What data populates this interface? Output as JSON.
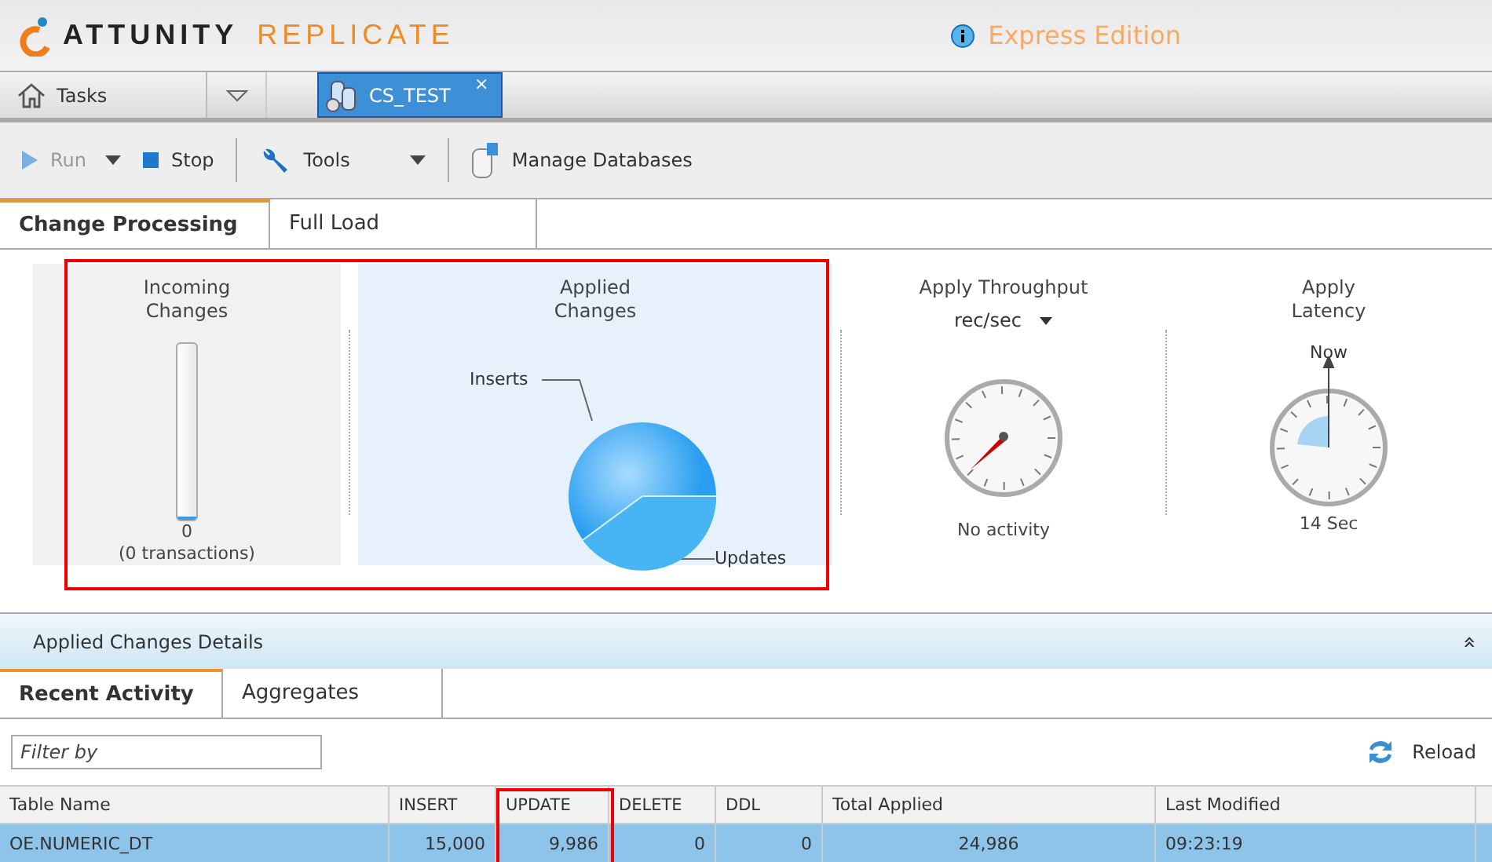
{
  "header": {
    "brand_left": "ATTUNITY",
    "brand_right": "REPLICATE",
    "edition": "Express Edition"
  },
  "task_tabs": [
    {
      "label": "Tasks",
      "kind": "home",
      "selected": false
    },
    {
      "label": "CS_TEST",
      "kind": "task",
      "selected": true,
      "close": "×"
    }
  ],
  "toolbar": [
    {
      "label": "Run",
      "kind": "run",
      "disabled": true,
      "dropdown": true
    },
    {
      "label": "Stop",
      "kind": "stop",
      "disabled": false,
      "dropdown": false
    },
    {
      "label": "Tools",
      "kind": "tools",
      "disabled": false,
      "dropdown": true
    },
    {
      "label": "Manage Databases",
      "kind": "db",
      "disabled": false,
      "dropdown": false
    }
  ],
  "view_tabs": [
    {
      "label": "Change Processing",
      "selected": true
    },
    {
      "label": "Full Load",
      "selected": false
    }
  ],
  "metrics": {
    "incoming": {
      "title": "Incoming Changes",
      "level": 0.0,
      "value": "0",
      "note": "(0 transactions)"
    },
    "applied": {
      "title": "Applied Changes",
      "labels": [
        "Inserts",
        "Updates"
      ]
    },
    "throughput": {
      "title": "Apply Throughput",
      "unit": "rec/sec",
      "status": "No activity"
    },
    "latency": {
      "title": "Apply Latency",
      "marker": "Now",
      "value": "14 Sec"
    }
  },
  "details": {
    "title": "Applied Changes Details",
    "collapse": "«",
    "tabs": [
      {
        "label": "Recent Activity",
        "selected": true
      },
      {
        "label": "Aggregates",
        "selected": false
      }
    ],
    "filter": {
      "placeholder": "Filter by"
    },
    "reload": "Reload",
    "table": {
      "columns": [
        "Table Name",
        "INSERT",
        "UPDATE",
        "DELETE",
        "DDL",
        "Total Applied",
        "Last Modified"
      ],
      "rows": [
        {
          "selected": true,
          "cells": [
            "OE.NUMERIC_DT",
            "15,000",
            "9,986",
            "0",
            "0",
            "24,986",
            "09:23:19"
          ]
        }
      ]
    }
  }
}
